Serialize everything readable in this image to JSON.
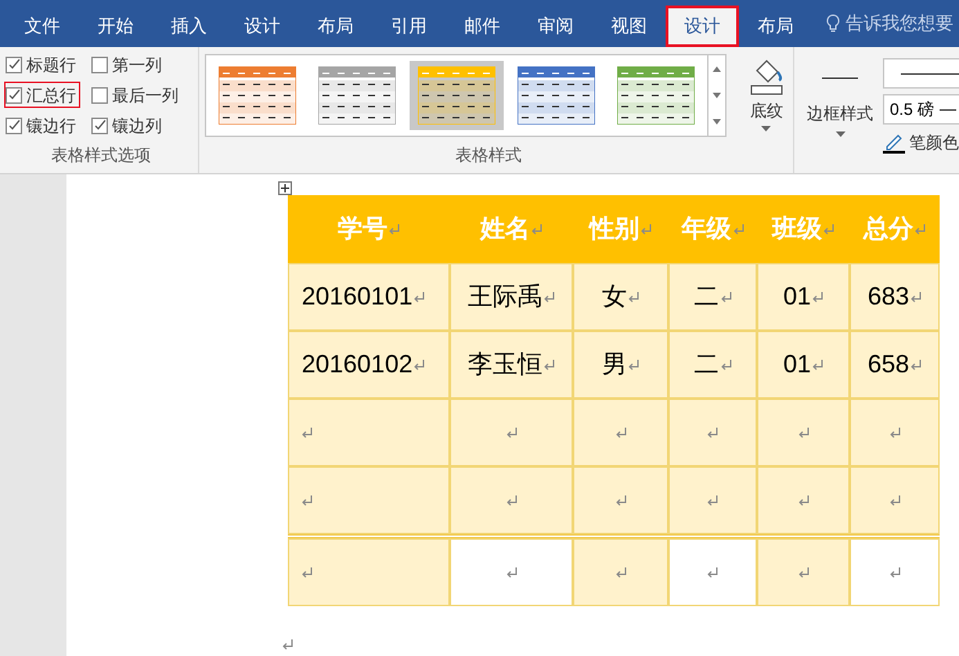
{
  "tabs": [
    {
      "label": "文件",
      "selected": false,
      "highlighted": false
    },
    {
      "label": "开始",
      "selected": false,
      "highlighted": false
    },
    {
      "label": "插入",
      "selected": false,
      "highlighted": false
    },
    {
      "label": "设计",
      "selected": false,
      "highlighted": false
    },
    {
      "label": "布局",
      "selected": false,
      "highlighted": false
    },
    {
      "label": "引用",
      "selected": false,
      "highlighted": false
    },
    {
      "label": "邮件",
      "selected": false,
      "highlighted": false
    },
    {
      "label": "审阅",
      "selected": false,
      "highlighted": false
    },
    {
      "label": "视图",
      "selected": false,
      "highlighted": false
    },
    {
      "label": "设计",
      "selected": true,
      "highlighted": true
    },
    {
      "label": "布局",
      "selected": false,
      "highlighted": false
    }
  ],
  "tell_me": {
    "placeholder": "告诉我您想要"
  },
  "style_options": {
    "label": "表格样式选项",
    "options": [
      {
        "label": "标题行",
        "checked": true,
        "highlighted": false
      },
      {
        "label": "第一列",
        "checked": false,
        "highlighted": false
      },
      {
        "label": "汇总行",
        "checked": true,
        "highlighted": true
      },
      {
        "label": "最后一列",
        "checked": false,
        "highlighted": false
      },
      {
        "label": "镶边行",
        "checked": true,
        "highlighted": false
      },
      {
        "label": "镶边列",
        "checked": true,
        "highlighted": false
      }
    ]
  },
  "table_styles": {
    "label": "表格样式",
    "styles": [
      {
        "color": "#ed7d31",
        "selected": false
      },
      {
        "color": "#a5a5a5",
        "selected": false
      },
      {
        "color": "#ffc000",
        "selected": true
      },
      {
        "color": "#4472c4",
        "selected": false
      },
      {
        "color": "#70ad47",
        "selected": false
      }
    ]
  },
  "shading": {
    "label": "底纹"
  },
  "border_styles": {
    "label": "边框样式"
  },
  "pen_weight": {
    "value": "0.5 磅"
  },
  "pen_color": {
    "label": "笔颜色"
  },
  "table": {
    "rows": [
      {
        "kind": "header",
        "cells": [
          {
            "text": "学号"
          },
          {
            "text": "姓名"
          },
          {
            "text": "性别"
          },
          {
            "text": "年级"
          },
          {
            "text": "班级"
          },
          {
            "text": "总分"
          }
        ]
      },
      {
        "kind": "body",
        "cells": [
          {
            "text": "20160101",
            "shaded": true
          },
          {
            "text": "王际禹",
            "shaded": true
          },
          {
            "text": "女",
            "shaded": true
          },
          {
            "text": "二",
            "shaded": true
          },
          {
            "text": "01",
            "shaded": true
          },
          {
            "text": "683",
            "shaded": true
          }
        ]
      },
      {
        "kind": "body",
        "cells": [
          {
            "text": "20160102",
            "shaded": true
          },
          {
            "text": "李玉恒",
            "shaded": true
          },
          {
            "text": "男",
            "shaded": true
          },
          {
            "text": "二",
            "shaded": true
          },
          {
            "text": "01",
            "shaded": true
          },
          {
            "text": "658",
            "shaded": true
          }
        ]
      },
      {
        "kind": "body",
        "cells": [
          {
            "shaded": true
          },
          {
            "shaded": true
          },
          {
            "shaded": true
          },
          {
            "shaded": true
          },
          {
            "shaded": true
          },
          {
            "shaded": true
          }
        ]
      },
      {
        "kind": "body",
        "cells": [
          {
            "shaded": true
          },
          {
            "shaded": true
          },
          {
            "shaded": true
          },
          {
            "shaded": true
          },
          {
            "shaded": true
          },
          {
            "shaded": true
          }
        ]
      },
      {
        "kind": "total",
        "cells": [
          {
            "shaded": true
          },
          {
            "shaded": false
          },
          {
            "shaded": true
          },
          {
            "shaded": false
          },
          {
            "shaded": true
          },
          {
            "shaded": false
          }
        ]
      }
    ]
  }
}
